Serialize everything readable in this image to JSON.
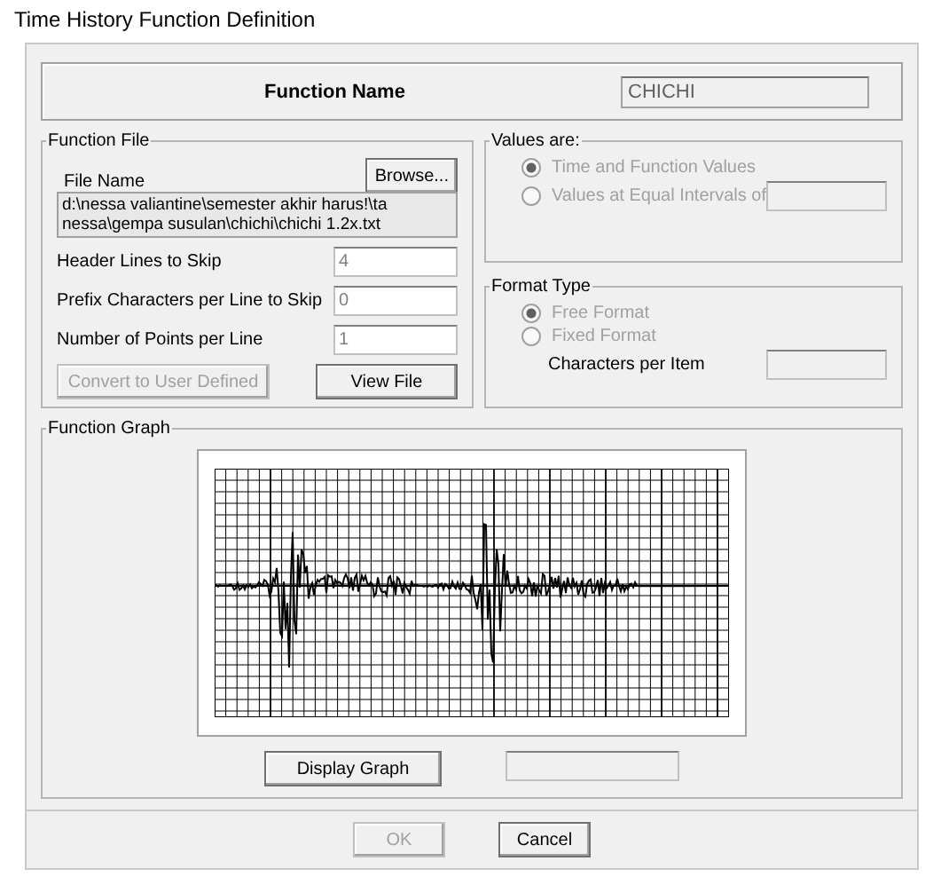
{
  "window": {
    "title": "Time History  Function Definition"
  },
  "function_name": {
    "label": "Function Name",
    "value": "CHICHI"
  },
  "function_file": {
    "title": "Function File",
    "file_name_label": "File Name",
    "browse": "Browse...",
    "file_path_lines": [
      "d:\\nessa valiantine\\semester akhir harus!\\ta",
      "nessa\\gempa susulan\\chichi\\chichi 1.2x.txt"
    ],
    "fields": [
      {
        "label": "Header Lines to Skip",
        "value": "4"
      },
      {
        "label": "Prefix Characters per Line to Skip",
        "value": "0"
      },
      {
        "label": "Number of Points per Line",
        "value": "1"
      }
    ],
    "convert_button": {
      "label": "Convert to User Defined",
      "disabled": true
    },
    "view_button": {
      "label": "View File",
      "disabled": false
    }
  },
  "values_are": {
    "title": "Values are:",
    "options": [
      {
        "label": "Time and Function Values",
        "selected": true,
        "disabled": true
      },
      {
        "label": "Values at Equal Intervals of",
        "selected": false,
        "disabled": true
      }
    ]
  },
  "format_type": {
    "title": "Format Type",
    "options": [
      {
        "label": "Free Format",
        "selected": true,
        "disabled": true
      },
      {
        "label": "Fixed Format",
        "selected": false,
        "disabled": true
      }
    ],
    "characters_label": "Characters per Item"
  },
  "graph": {
    "title": "Function Graph",
    "display_button": "Display Graph"
  },
  "buttons": [
    {
      "label": "OK",
      "disabled": true
    },
    {
      "label": "Cancel",
      "disabled": false
    }
  ]
}
